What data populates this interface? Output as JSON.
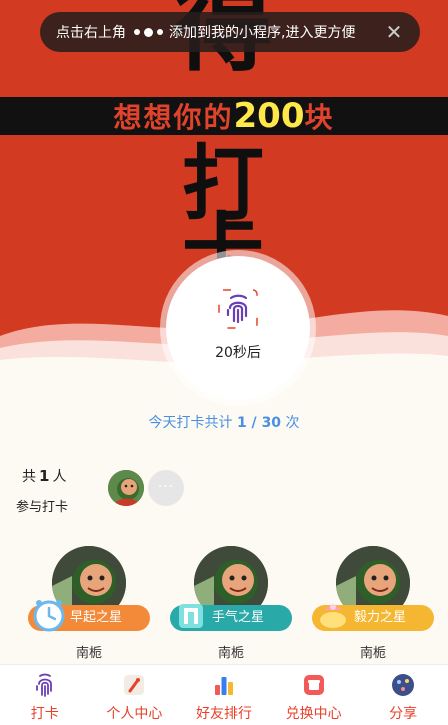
{
  "toast": {
    "text_before": "点击右上角",
    "text_after": "添加到我的小程序,进入更方便",
    "close": "✕"
  },
  "hero": {
    "big_top": "得",
    "slogan_prefix": "想想你的",
    "slogan_number": "200",
    "slogan_suffix": "块",
    "big_mid": "打",
    "big_low": "卡"
  },
  "punch": {
    "icon": "fingerprint-icon",
    "countdown": "20秒后"
  },
  "summary": {
    "prefix": "今天打卡共计 ",
    "done": "1",
    "separator": " / ",
    "total": "30",
    "suffix": " 次"
  },
  "participants": {
    "prefix": "共",
    "count": "1",
    "unit": "人",
    "label": "参与打卡",
    "more": "···"
  },
  "stars": [
    {
      "title": "早起之星",
      "name": "南栀",
      "color": "#f38a3a",
      "icon": "clock-icon"
    },
    {
      "title": "手气之星",
      "name": "南栀",
      "color": "#2aa9a9",
      "icon": "gift-icon"
    },
    {
      "title": "毅力之星",
      "name": "南栀",
      "color": "#f5b731",
      "icon": "trophy-icon"
    }
  ],
  "tabs": [
    {
      "label": "打卡",
      "icon": "fingerprint-icon",
      "color": "#e8412a"
    },
    {
      "label": "个人中心",
      "icon": "user-icon",
      "color": "#e8412a"
    },
    {
      "label": "好友排行",
      "icon": "ranking-icon",
      "color": "#e8412a"
    },
    {
      "label": "兑换中心",
      "icon": "exchange-icon",
      "color": "#e8412a"
    },
    {
      "label": "分享",
      "icon": "share-icon",
      "color": "#e8412a"
    }
  ]
}
